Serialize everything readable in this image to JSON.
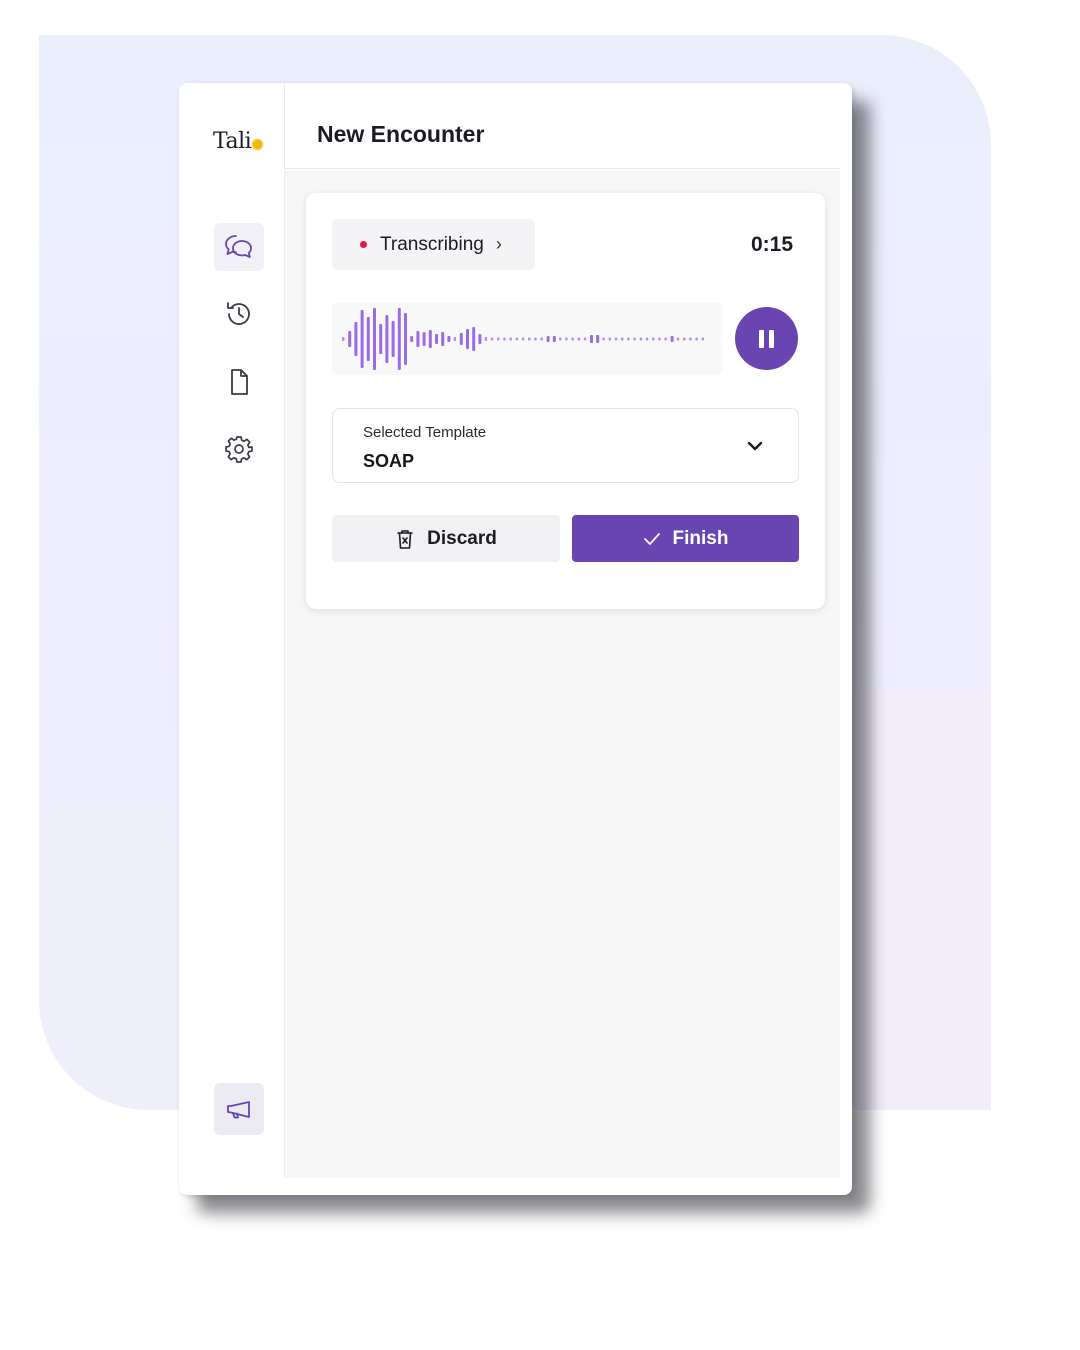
{
  "app": {
    "logo_text": "Tali",
    "accent_color": "#6a45b2",
    "logo_dot_color": "#f2b705"
  },
  "sidebar": {
    "items": [
      {
        "icon": "chat-bubbles-icon",
        "active": true
      },
      {
        "icon": "history-icon",
        "active": false
      },
      {
        "icon": "document-icon",
        "active": false
      },
      {
        "icon": "gear-icon",
        "active": false
      }
    ],
    "footer_item": {
      "icon": "megaphone-icon"
    }
  },
  "header": {
    "title": "New Encounter"
  },
  "recorder": {
    "status_label": "Transcribing",
    "status_dot_color": "#e4173f",
    "timer": "0:15",
    "pause_icon": "pause-icon"
  },
  "template": {
    "label": "Selected Template",
    "value": "SOAP"
  },
  "actions": {
    "discard_label": "Discard",
    "finish_label": "Finish"
  }
}
